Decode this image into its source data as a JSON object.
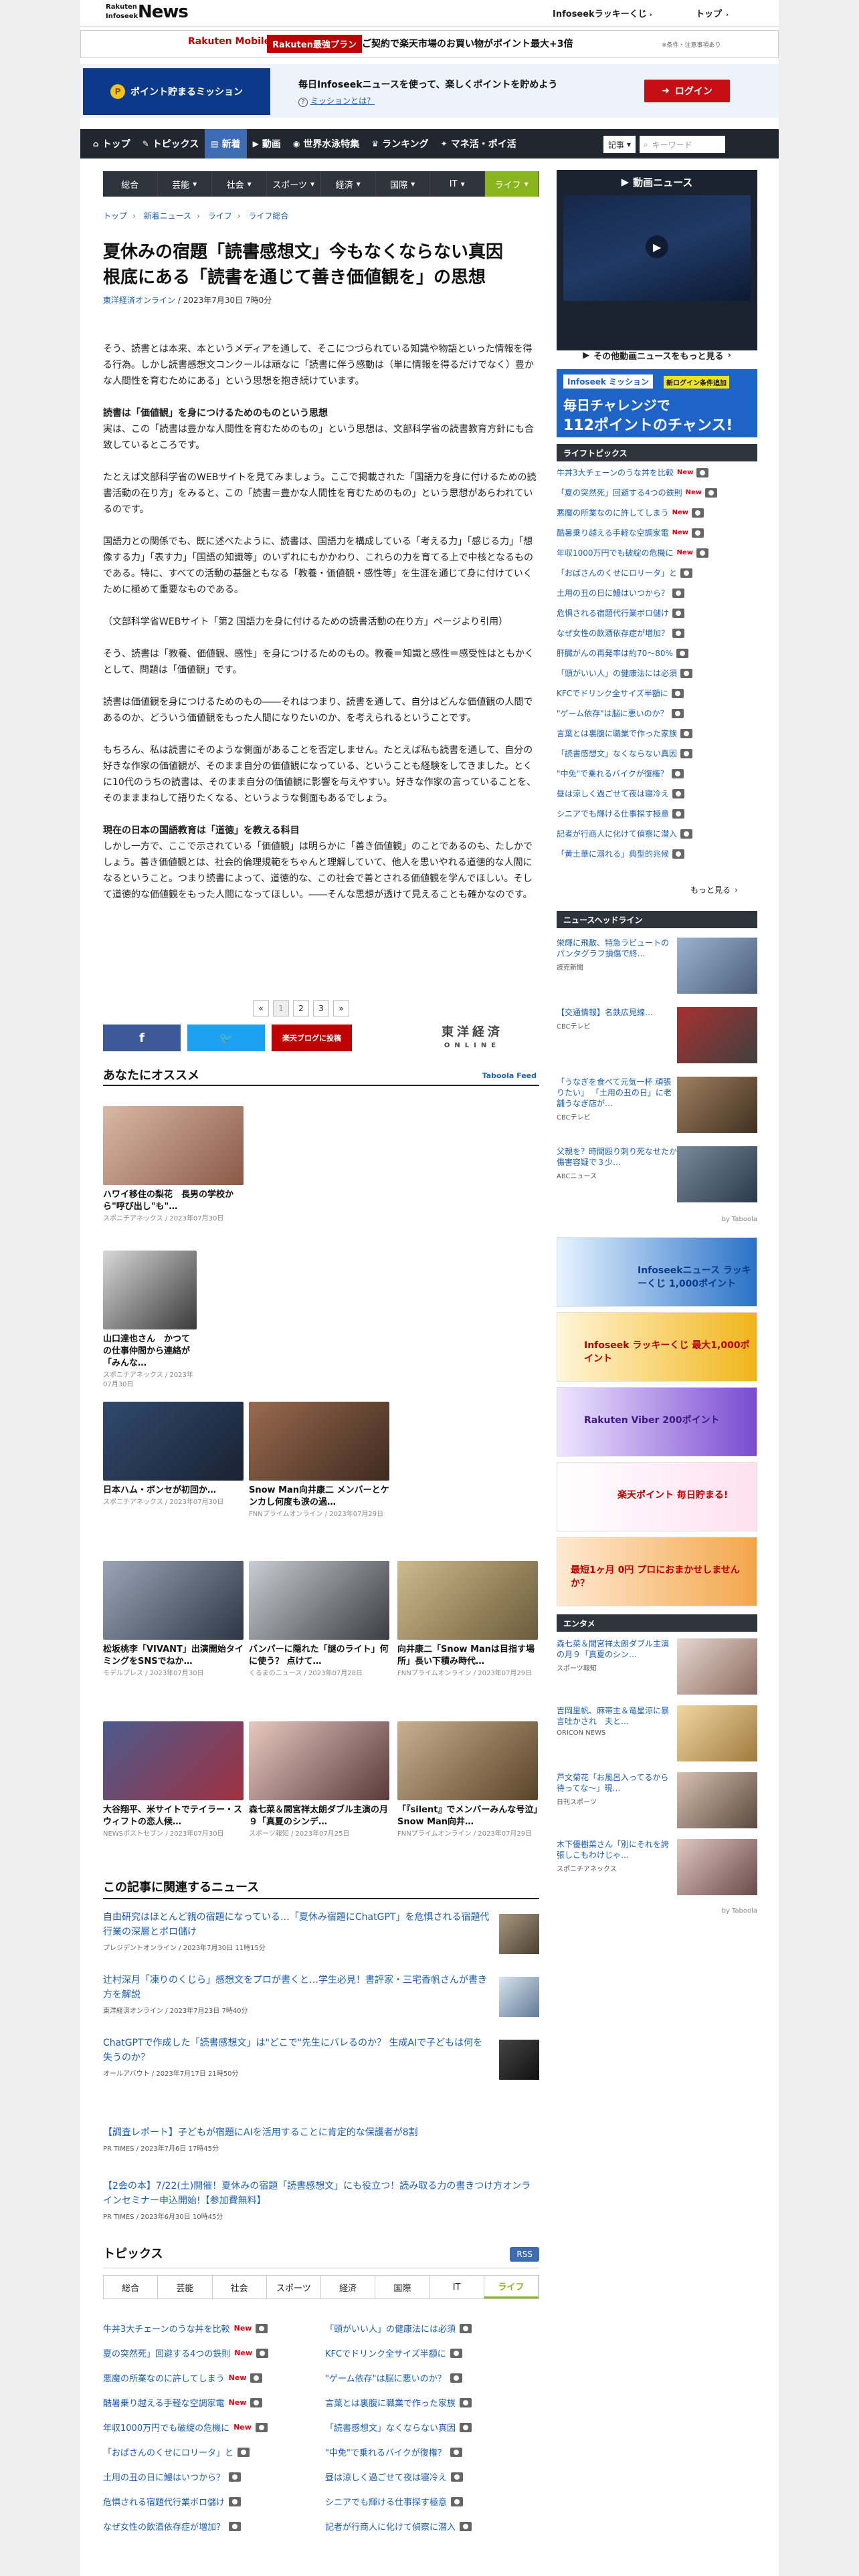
{
  "header": {
    "logo_top": "Rakuten",
    "logo_mid": "Infoseek",
    "logo_brand": "News",
    "lucky": "Infoseekラッキーくじ",
    "top": "トップ"
  },
  "ad_banner": {
    "mobile": "Rakuten Mobile",
    "plan": "Rakuten最強プラン",
    "text": "ご契約で楽天市場のお買い物がポイント最大+3倍",
    "note": "※条件・注意事項あり"
  },
  "mission": {
    "button": "ポイント貯まるミッション",
    "text": "毎日Infoseekニュースを使って、楽しくポイントを貯めよう",
    "link": "ミッションとは？",
    "login": "ログイン"
  },
  "nav": {
    "items": [
      {
        "icon": "⌂",
        "label": "トップ"
      },
      {
        "icon": "✎",
        "label": "トピックス"
      },
      {
        "icon": "▤",
        "label": "新着"
      },
      {
        "icon": "▶",
        "label": "動画"
      },
      {
        "icon": "◉",
        "label": "世界水泳特集"
      },
      {
        "icon": "♛",
        "label": "ランキング"
      },
      {
        "icon": "✦",
        "label": "マネ活・ポイ活"
      }
    ],
    "select": "記事",
    "search_placeholder": "キーワード"
  },
  "categories": [
    "総合",
    "芸能",
    "社会",
    "スポーツ",
    "経済",
    "国際",
    "IT",
    "ライフ"
  ],
  "breadcrumb": [
    "トップ",
    "新着ニュース",
    "ライフ",
    "ライフ総合"
  ],
  "article": {
    "title": "夏休みの宿題「読書感想文」今もなくならない真因　根底にある「読書を通じて善き価値観を」の思想",
    "source": "東洋経済オンライン",
    "date": "/ 2023年7月30日 7時0分",
    "p1": "そう、読書とは本来、本というメディアを通して、そこにつづられている知識や物語といった情報を得る行為。しかし読書感想文コンクールは頑なに「読書に伴う感動は（単に情報を得るだけでなく）豊かな人間性を育むためにある」という思想を抱き続けています。",
    "h1": "読書は「価値観」を身につけるためのものという思想",
    "p2": "実は、この「読書は豊かな人間性を育むためのもの」という思想は、文部科学省の読書教育方針にも合致しているところです。",
    "p3": "たとえば文部科学省のWEBサイトを見てみましょう。ここで掲載された「国語力を身に付けるための読書活動の在り方」をみると、この「読書＝豊かな人間性を育むためのもの」という思想があらわれているのです。",
    "p4": "国語力との関係でも、既に述べたように、読書は、国語力を構成している「考える力」「感じる力」「想像する力」「表す力」「国語の知識等」のいずれにもかかわり、これらの力を育てる上で中核となるものである。特に、すべての活動の基盤ともなる「教養・価値観・感性等」を生涯を通じて身に付けていくために極めて重要なものである。",
    "p5": "（文部科学省WEBサイト「第2 国語力を身に付けるための読書活動の在り方」ページより引用）",
    "p6": "そう、読書は「教養、価値観、感性」を身につけるためのもの。教養＝知識と感性＝感受性はともかくとして、問題は「価値観」です。",
    "p7": "読書は価値観を身につけるためのもの――それはつまり、読書を通して、自分はどんな価値観の人間であるのか、どういう価値観をもった人間になりたいのか、を考えられるということです。",
    "p8": "もちろん、私は読書にそのような側面があることを否定しません。たとえば私も読書を通して、自分の好きな作家の価値観が、そのまま自分の価値観になっている、ということも経験をしてきました。とくに10代のうちの読書は、そのまま自分の価値観に影響を与えやすい。好きな作家の言っていることを、そのまままねして語りたくなる、というような側面もあるでしょう。",
    "h2": "現在の日本の国語教育は「道徳」を教える科目",
    "p9": "しかし一方で、ここで示されている「価値観」は明らかに「善き価値観」のことであるのも、たしかでしょう。善き価値観とは、社会的倫理規範をちゃんと理解していて、他人を思いやれる道徳的な人間になるということ。つまり読書によって、道徳的な、この社会で善とされる価値観を学んでほしい。そして道徳的な価値観をもった人間になってほしい。――そんな思想が透けて見えることも確かなのです。"
  },
  "pager": {
    "prev": "«",
    "pages": [
      "1",
      "2",
      "3"
    ],
    "next": "»"
  },
  "share": {
    "facebook": "f",
    "twitter": "🐦",
    "blog": "楽天ブログに投稿"
  },
  "toyo": {
    "l1": "東洋経済",
    "l2": "ONLINE"
  },
  "recommend": {
    "heading": "あなたにオススメ",
    "feed": "Taboola Feed",
    "items": [
      {
        "title": "ハワイ移住の梨花　長男の学校から\"呼び出し\"も\"…",
        "meta": "スポニチアネックス / 2023年07月30日"
      },
      {
        "title": "山口達也さん　かつての仕事仲間から連絡が「みんな…",
        "meta": "スポニチアネックス / 2023年07月30日"
      },
      {
        "title": "日本ハム・ボンセが初回か…",
        "meta": "スポニチアネックス / 2023年07月30日"
      },
      {
        "title": "Snow Man向井康二 メンバーとケンカし何度も涙の過…",
        "meta": "FNNプライムオンライン / 2023年07月29日"
      },
      {
        "title": "松坂桃李「VIVANT」出演開始タイミングをSNSでねか…",
        "meta": "モデルプレス / 2023年07月30日"
      },
      {
        "title": "バンパーに隠れた「謎のライト」何に使う？ 点けて…",
        "meta": "くるまのニュース / 2023年07月28日"
      },
      {
        "title": "向井康二「Snow Manは目指す場所」長い下積み時代…",
        "meta": "FNNプライムオンライン / 2023年07月29日"
      },
      {
        "title": "大谷翔平、米サイトでテイラー・スウィフトの恋人候…",
        "meta": "NEWSポストセブン / 2023年07月30日"
      },
      {
        "title": "森七菜＆間宮祥太朗ダブル主演の月９「真夏のシンデ…",
        "meta": "スポーツ報知 / 2023年07月25日"
      },
      {
        "title": "「『silent』でメンバーみんな号泣」Snow Man向井…",
        "meta": "FNNプライムオンライン / 2023年07月29日"
      }
    ]
  },
  "related": {
    "heading": "この記事に関連するニュース",
    "items": [
      {
        "title": "自由研究はほとんど親の宿題になっている…「夏休み宿題にChatGPT」を危惧される宿題代行業の深層とポロ儲け",
        "meta": "プレジデントオンライン / 2023年7月30日 11時15分"
      },
      {
        "title": "辻村深月「凍りのくじら」感想文をプロが書くと…学生必見！書評家・三宅香帆さんが書き方を解説",
        "meta": "東洋経済オンライン / 2023年7月23日 7時40分"
      },
      {
        "title": "ChatGPTで作成した「読書感想文」は\"どこで\"先生にバレるのか？ 生成AIで子どもは何を失うのか？",
        "meta": "オールアバウト / 2023年7月17日 21時50分"
      },
      {
        "title": "【調査レポート】子どもが宿題にAIを活用することに肯定的な保護者が8割",
        "meta": "PR TIMES / 2023年7月6日 17時45分"
      },
      {
        "title": "【2会の本】7/22(土)開催！夏休みの宿題「読書感想文」にも役立つ！読み取る力の書きつけ方オンラインセミナー申込開始!【参加費無料】",
        "meta": "PR TIMES / 2023年6月30日 10時45分"
      }
    ]
  },
  "topics": {
    "heading": "トピックス",
    "rss": "RSS",
    "tabs": [
      "総合",
      "芸能",
      "社会",
      "スポーツ",
      "経済",
      "国際",
      "IT",
      "ライフ"
    ],
    "left": [
      "牛丼3大チェーンのうな丼を比較",
      "夏の突然死」回避する4つの鉄則",
      "悪魔の所業なのに許してしまう",
      "酷暑乗り越える手軽な空調家電",
      "年収1000万円でも破綻の危機に",
      "「おばさんのくせにロリータ」と",
      "土用の丑の日に鰻はいつから？",
      "危惧される宿題代行業ボロ儲け",
      "なぜ女性の飲酒依存症が増加？"
    ],
    "leftnew": [
      true,
      true,
      true,
      true,
      true,
      false,
      false,
      false,
      false
    ],
    "right": [
      "「頭がいい人」の健康法には必須",
      "KFCでドリンク全サイズ半額に",
      "\"ゲーム依存\"は脳に悪いのか？",
      "言葉とは裏腹に職業で作った家族",
      "「読書感想文」なくならない真因",
      "\"中免\"で乗れるバイクが復権？",
      "昼は涼しく過ごせて夜は寝冷え",
      "シニアでも輝ける仕事探す極意",
      "記者が行商人に化けて偵察に潜入"
    ]
  },
  "sidebar": {
    "video_heading": "動画ニュース",
    "video_more": "その他動画ニュースをもっと見る",
    "ad2": {
      "tag": "Infoseek ミッション",
      "new": "新ログイン条件追加",
      "l1": "毎日チャレンジで",
      "l2": "112ポイントのチャンス!"
    },
    "life_heading": "ライフトピックス",
    "life": [
      "牛丼3大チェーンのうな丼を比較",
      "「夏の突然死」回避する4つの鉄則",
      "悪魔の所業なのに許してしまう",
      "酷暑乗り越える手軽な空調家電",
      "年収1000万円でも破綻の危機に",
      "「おばさんのくせにロリータ」と",
      "土用の丑の日に鰻はいつから？",
      "危惧される宿題代行業ボロ儲け",
      "なぜ女性の飲酒依存症が増加？",
      "肝臓がんの再発率は約70～80%",
      "「頭がいい人」の健康法には必須",
      "KFCでドリンク全サイズ半額に",
      "\"ゲーム依存\"は脳に悪いのか？",
      "言葉とは裏腹に職業で作った家族",
      "「読書感想文」なくならない真因",
      "\"中免\"で乗れるバイクが復権？",
      "昼は涼しく過ごせて夜は寝冷え",
      "シニアでも輝ける仕事探す極意",
      "記者が行商人に化けて偵察に潜入",
      "「黄土華に溺れる」典型的兆候"
    ],
    "life_new": [
      true,
      true,
      true,
      true,
      true,
      false,
      false,
      false,
      false,
      false,
      false,
      false,
      false,
      false,
      false,
      false,
      false,
      false,
      false,
      false
    ],
    "more": "もっと見る",
    "headline_heading": "ニュースヘッドライン",
    "headlines": [
      {
        "title": "栄輝に飛散、特急ラピュートのパンタグラフ損傷で終…",
        "meta": "読売新聞"
      },
      {
        "title": "【交通情報】名鉄広見線…",
        "meta": "CBCテレビ"
      },
      {
        "title": "「うなぎを食べて元気一杯 頑張りたい」 「土用の丑の日」に老舗うなぎ店が…",
        "meta": "CBCテレビ"
      },
      {
        "title": "父親を？時間殴り刺り死なせたか　傷害容疑で３少…",
        "meta": "ABCニュース"
      }
    ],
    "taboola": "by Taboola",
    "ads": [
      "Infoseekニュース ラッキーくじ 1,000ポイント",
      "Infoseek ラッキーくじ 最大1,000ポイント",
      "Rakuten Viber 200ポイント",
      "楽天ポイント 毎日貯まる!",
      "最短1ヶ月 0円 プロにおまかせしませんか？"
    ],
    "ent_heading": "エンタメ",
    "ent": [
      {
        "title": "森七菜＆間宮祥太朗ダブル主演の月９「真夏のシン…",
        "meta": "スポーツ報知"
      },
      {
        "title": "吉岡里帆、麻帯主＆竜星涼に暴言吐かされ　夫と…",
        "meta": "ORICON NEWS"
      },
      {
        "title": "芦文菊花「お風呂入ってるから待ってな～」現…",
        "meta": "日刊スポーツ"
      },
      {
        "title": "木下優樹菜さん「別にそれを誇張しこもわけじゃ…",
        "meta": "スポニチアネックス"
      }
    ]
  }
}
